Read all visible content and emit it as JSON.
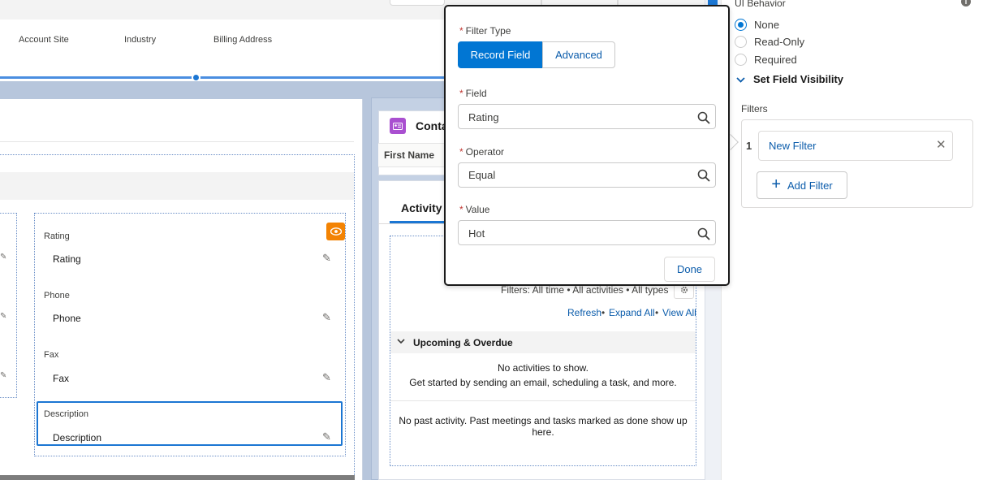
{
  "highlights": {
    "fields": [
      "Account Site",
      "Industry",
      "Billing Address"
    ]
  },
  "details": {
    "fields": [
      {
        "label": "Rating",
        "value": "Rating"
      },
      {
        "label": "Phone",
        "value": "Phone"
      },
      {
        "label": "Fax",
        "value": "Fax"
      },
      {
        "label": "Description",
        "value": "Description"
      }
    ]
  },
  "contacts": {
    "title": "Conta",
    "column_first": "First Name"
  },
  "activity": {
    "tab": "Activity",
    "filters_text": "Filters: All time • All activities • All types",
    "links": [
      "Refresh",
      "Expand All",
      "View All"
    ],
    "link_sep": "•",
    "upcoming_title": "Upcoming & Overdue",
    "no_activities": "No activities to show.",
    "get_started": "Get started by sending an email, scheduling a task, and more.",
    "no_past": "No past activity. Past meetings and tasks marked as done show up here."
  },
  "filter_popover": {
    "required_mark": "*",
    "filter_type_label": "Filter Type",
    "type_options": [
      "Record Field",
      "Advanced"
    ],
    "field_label": "Field",
    "field_value": "Rating",
    "operator_label": "Operator",
    "operator_value": "Equal",
    "value_label": "Value",
    "value_value": "Hot",
    "done_label": "Done"
  },
  "panel": {
    "ui_behavior_label": "UI Behavior",
    "info_icon": "i",
    "ui_behavior_options": [
      "None",
      "Read-Only",
      "Required"
    ],
    "selected_option": "None",
    "set_field_visibility": "Set Field Visibility",
    "filters_label": "Filters",
    "filter_number": "1",
    "filter_name": "New Filter",
    "close_glyph": "✕",
    "add_filter_label": "Add Filter",
    "add_glyph": "+"
  },
  "colors": {
    "brand_blue": "#0176d3",
    "link_blue": "#0b5cab",
    "accent_orange": "#f38303",
    "contacts_purple": "#a94fd0",
    "required_red": "#c23934"
  }
}
